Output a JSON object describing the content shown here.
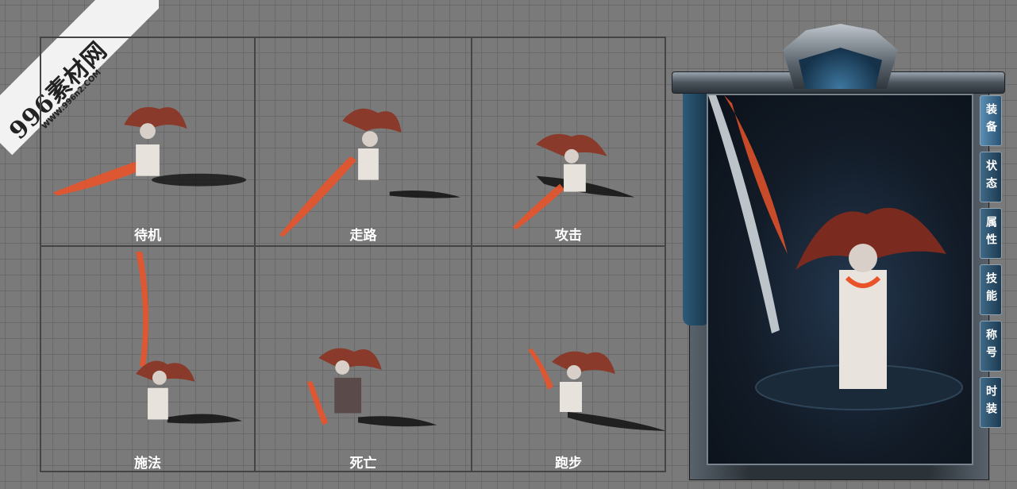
{
  "watermark": {
    "brand": "996素材网",
    "url": "WWW.996n2.COM"
  },
  "sprite_grid": {
    "cells": [
      {
        "label": "待机"
      },
      {
        "label": "走路"
      },
      {
        "label": "攻击"
      },
      {
        "label": "施法"
      },
      {
        "label": "死亡"
      },
      {
        "label": "跑步"
      }
    ]
  },
  "panel": {
    "tabs": [
      "装备",
      "状态",
      "属性",
      "技能",
      "称号",
      "时装"
    ],
    "active_tab": "装备"
  },
  "colors": {
    "grid_bg": "#7a7a7a",
    "grid_line": "#6a6a6a",
    "cell_border": "#444444",
    "fire": "#e8532a",
    "panel_blue": "#1d3a50"
  }
}
